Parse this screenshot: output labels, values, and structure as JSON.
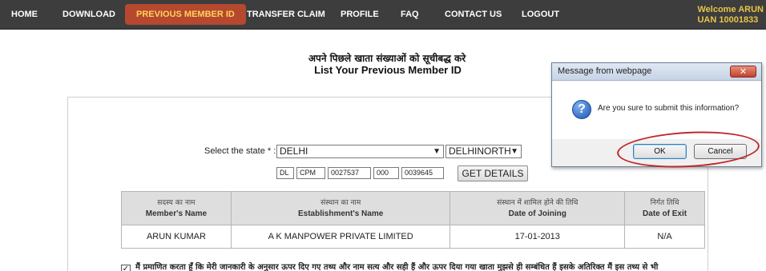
{
  "nav": {
    "items": [
      {
        "label": "HOME"
      },
      {
        "label": "DOWNLOAD"
      },
      {
        "label": "PREVIOUS MEMBER ID"
      },
      {
        "label": "TRANSFER CLAIM"
      },
      {
        "label": "PROFILE"
      },
      {
        "label": "FAQ"
      },
      {
        "label": "CONTACT US"
      },
      {
        "label": "LOGOUT"
      }
    ],
    "active": "PREVIOUS MEMBER ID",
    "welcome_line": "Welcome ARUN",
    "uan_line": "UAN  10001833"
  },
  "page": {
    "title_hindi": "अपने पिछले खाता संख्याओं को सूचीबद्ध करे",
    "title_english": "List Your Previous Member ID"
  },
  "form": {
    "state_label": "Select the state * :",
    "state_value": "DELHI",
    "office_value": "DELHINORTH",
    "member_id_parts": [
      "DL",
      "CPM",
      "0027537",
      "000",
      "0039645"
    ],
    "get_details_label": "GET DETAILS"
  },
  "table": {
    "headers": [
      {
        "hindi": "सदस्य का नाम",
        "english": "Member's Name"
      },
      {
        "hindi": "संस्थान का नाम",
        "english": "Establishment's Name"
      },
      {
        "hindi": "संस्थान में शामिल होने की तिथि",
        "english": "Date of Joining"
      },
      {
        "hindi": "निर्गत तिथि",
        "english": "Date of Exit"
      }
    ],
    "rows": [
      [
        "ARUN KUMAR",
        "A K MANPOWER PRIVATE LIMITED",
        "17-01-2013",
        "N/A"
      ]
    ]
  },
  "declaration": {
    "checked": true,
    "text": "मैं प्रमाणित करता हूँ कि मेरी जानकारी के अनुसार ऊपर दिए गए तथ्य और नाम सत्य और सही हैं और ऊपर दिया गया खाता मुझसे ही सम्बंधित हैं इसके अतिरिक्त मैं इस तथ्य से भी"
  },
  "dialog": {
    "title": "Message from webpage",
    "message": "Are you sure to submit this information?",
    "ok_label": "OK",
    "cancel_label": "Cancel",
    "close_symbol": "✕",
    "icon": "question-icon"
  }
}
